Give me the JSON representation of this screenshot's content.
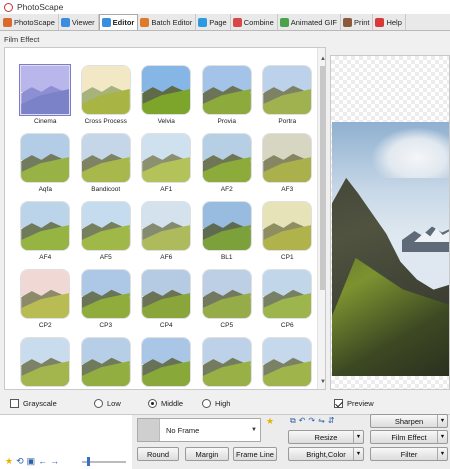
{
  "window": {
    "title": "PhotoScape"
  },
  "tabs": [
    {
      "label": "PhotoScape",
      "icon": "photoscape-icon",
      "color": "#d96a2b",
      "active": false
    },
    {
      "label": "Viewer",
      "icon": "viewer-icon",
      "color": "#3b8de0",
      "active": false
    },
    {
      "label": "Editor",
      "icon": "editor-icon",
      "color": "#3b8de0",
      "active": true
    },
    {
      "label": "Batch Editor",
      "icon": "batch-editor-icon",
      "color": "#e07a2b",
      "active": false
    },
    {
      "label": "Page",
      "icon": "page-icon",
      "color": "#2b9ae0",
      "active": false
    },
    {
      "label": "Combine",
      "icon": "combine-icon",
      "color": "#d94848",
      "active": false
    },
    {
      "label": "Animated GIF",
      "icon": "animated-gif-icon",
      "color": "#4aa34a",
      "active": false
    },
    {
      "label": "Print",
      "icon": "print-icon",
      "color": "#8a5a3a",
      "active": false
    },
    {
      "label": "Help",
      "icon": "help-icon",
      "color": "#d93838",
      "active": false
    }
  ],
  "panel": {
    "title": "Film Effect"
  },
  "effects": [
    {
      "label": "Cinema",
      "sky": "#b9b6ec",
      "mnt": "#8d8fd2",
      "grass": "#7c82c8",
      "selected": true
    },
    {
      "label": "Cross Process",
      "sky": "#f2e8c6",
      "mnt": "#a6b37a",
      "grass": "#a8b544",
      "selected": false
    },
    {
      "label": "Velvia",
      "sky": "#86b6e6",
      "mnt": "#5e6a48",
      "grass": "#7da52b",
      "selected": false
    },
    {
      "label": "Provia",
      "sky": "#a3c4e8",
      "mnt": "#6c7458",
      "grass": "#8dab3c",
      "selected": false
    },
    {
      "label": "Portra",
      "sky": "#bcd2ea",
      "mnt": "#7d8166",
      "grass": "#9fb24f",
      "selected": false
    },
    {
      "label": "Aqfa",
      "sky": "#b3cde6",
      "mnt": "#737b5e",
      "grass": "#98b246",
      "selected": false
    },
    {
      "label": "Bandicoot",
      "sky": "#c4d6e8",
      "mnt": "#7e8463",
      "grass": "#a8b84c",
      "selected": false
    },
    {
      "label": "AF1",
      "sky": "#cfe0ef",
      "mnt": "#8a9070",
      "grass": "#b4c25a",
      "selected": false
    },
    {
      "label": "AF2",
      "sky": "#b6cfe5",
      "mnt": "#6e7656",
      "grass": "#8cab3a",
      "selected": false
    },
    {
      "label": "AF3",
      "sky": "#d6d6c2",
      "mnt": "#878662",
      "grass": "#a9b04c",
      "selected": false
    },
    {
      "label": "AF4",
      "sky": "#bcd4ea",
      "mnt": "#6f7a5a",
      "grass": "#96b442",
      "selected": false
    },
    {
      "label": "AF5",
      "sky": "#c5dbee",
      "mnt": "#76805f",
      "grass": "#a0b848",
      "selected": false
    },
    {
      "label": "AF6",
      "sky": "#d4e2ee",
      "mnt": "#858b70",
      "grass": "#aebb5c",
      "selected": false
    },
    {
      "label": "BL1",
      "sky": "#98bce0",
      "mnt": "#5f6a52",
      "grass": "#7ca03a",
      "selected": false
    },
    {
      "label": "CP1",
      "sky": "#e6e3b8",
      "mnt": "#8e8e62",
      "grass": "#b0b24c",
      "selected": false
    },
    {
      "label": "CP2",
      "sky": "#f0d8d4",
      "mnt": "#8d8a6c",
      "grass": "#b8bc52",
      "selected": false
    },
    {
      "label": "CP3",
      "sky": "#adc8e6",
      "mnt": "#6a7458",
      "grass": "#8fac3c",
      "selected": false
    },
    {
      "label": "CP4",
      "sky": "#b4cbe3",
      "mnt": "#6c7256",
      "grass": "#8aa63a",
      "selected": false
    },
    {
      "label": "CP5",
      "sky": "#bccfe4",
      "mnt": "#727960",
      "grass": "#96ac48",
      "selected": false
    },
    {
      "label": "CP6",
      "sky": "#c2d6ea",
      "mnt": "#778064",
      "grass": "#9eb44c",
      "selected": false
    },
    {
      "label": "",
      "sky": "#c9dcee",
      "mnt": "#7b8266",
      "grass": "#a3b64e",
      "selected": false
    },
    {
      "label": "",
      "sky": "#b7cfe6",
      "mnt": "#707a5c",
      "grass": "#92ae40",
      "selected": false
    },
    {
      "label": "",
      "sky": "#a9c6e6",
      "mnt": "#687256",
      "grass": "#88a83a",
      "selected": false
    },
    {
      "label": "",
      "sky": "#bdd2e8",
      "mnt": "#747c60",
      "grass": "#98b046",
      "selected": false
    },
    {
      "label": "",
      "sky": "#c6d8eb",
      "mnt": "#7a8164",
      "grass": "#a0b44c",
      "selected": false
    }
  ],
  "options": {
    "grayscale": {
      "label": "Grayscale",
      "checked": false
    },
    "strength": [
      {
        "label": "Low",
        "selected": false
      },
      {
        "label": "Middle",
        "selected": true
      },
      {
        "label": "High",
        "selected": false
      }
    ],
    "preview": {
      "label": "Preview",
      "checked": true
    }
  },
  "frame": {
    "name": "No Frame"
  },
  "buttons": {
    "round": "Round",
    "margin": "Margin",
    "frame_line": "Frame Line",
    "resize": "Resize",
    "bright_color": "Bright,Color",
    "sharpen": "Sharpen",
    "film_effect": "Film Effect",
    "filter": "Filter"
  }
}
